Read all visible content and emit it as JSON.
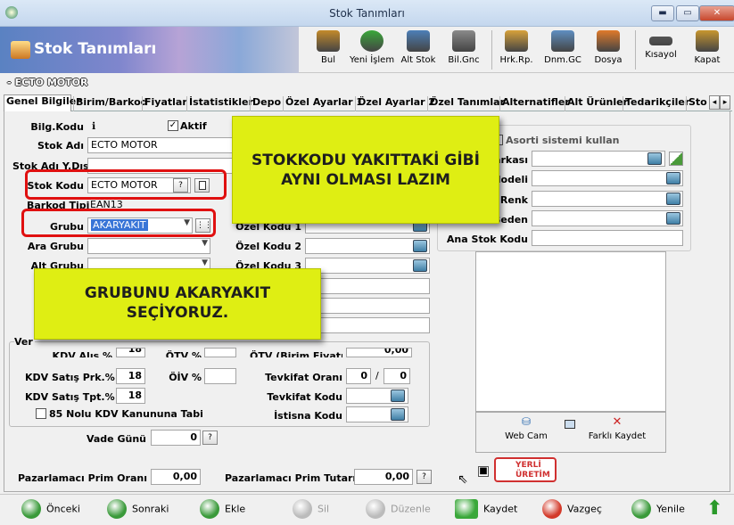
{
  "window": {
    "title": "Stok Tanımları",
    "min": "▬",
    "max": "▭",
    "close": "✕"
  },
  "banner": {
    "title": "Stok Tanımları"
  },
  "toolbar": [
    {
      "label": "Bul",
      "color": "#c48a2a"
    },
    {
      "label": "Yeni İşlem",
      "color": "#3aa83a"
    },
    {
      "label": "Alt Stok",
      "color": "#4d7fb8"
    },
    {
      "label": "Bil.Gnc",
      "color": "#8a8a8a"
    },
    {
      "label": "Hrk.Rp.",
      "color": "#d8a23a"
    },
    {
      "label": "Dnm.GC",
      "color": "#5f8fc2"
    },
    {
      "label": "Dosya",
      "color": "#e07a2a"
    },
    {
      "label": "Kısayol",
      "color": "#555555"
    },
    {
      "label": "Kapat",
      "color": "#c8962e"
    }
  ],
  "subheader": "ECTO MOTOR",
  "tabs": [
    "Genel Bilgiler",
    "Birim/Barkod",
    "Fiyatlar",
    "İstatistikler",
    "Depo",
    "Özel Ayarlar 1",
    "Özel Ayarlar 2",
    "Özel Tanımlar",
    "Alternatifler",
    "Alt Ürünler",
    "Tedarikçiler",
    "Stol"
  ],
  "tab_scroll": [
    "◂",
    "▸"
  ],
  "form": {
    "bilg_kodu_label": "Bilg.Kodu",
    "bilg_kodu_icon": "ℹ",
    "aktif_label": "Aktif",
    "aktif_check": "✓",
    "stok_adi_label": "Stok Adı",
    "stok_adi": "ECTO MOTOR",
    "stok_adi_y_label": "Stok Adı Y.Dışı",
    "stok_kodu_label": "Stok Kodu",
    "stok_kodu": "ECTO MOTOR",
    "stok_kodu_btn": "?",
    "barkod_tipi_label": "Barkod Tipi",
    "barkod_tipi": "EAN13",
    "grubu_label": "Grubu",
    "grubu": "AKARYAKIT",
    "ara_grubu_label": "Ara Grubu",
    "alt_grubu_label": "Alt Grubu",
    "ozel_kodu_1_label": "Özel Kodu 1",
    "ozel_kodu_2_label": "Özel Kodu 2",
    "ozel_kodu_3_label": "Özel Kodu 3",
    "ver_label": "Ver",
    "kdv_alis_label": "KDV Alış %",
    "kdv_alis": "18",
    "kdv_satis_prk_label": "KDV Satış Prk.%",
    "kdv_satis_prk": "18",
    "kdv_satis_tpt_label": "KDV Satış Tpt.%",
    "kdv_satis_tpt": "18",
    "otv_label": "ÖTV %",
    "oiv_label": "ÖİV %",
    "otv_birim_label": "ÖTV (Birim Fiyatı)",
    "otv_birim": "0,00",
    "tevkifat_orani_label": "Tevkifat Oranı",
    "tevkifat_1": "0",
    "tevkifat_sep": "/",
    "tevkifat_2": "0",
    "tevkifat_kodu_label": "Tevkifat Kodu",
    "istisna_kodu_label": "İstisna Kodu",
    "kdv85_label": "85 Nolu KDV Kanununa Tabi",
    "vade_gunu_label": "Vade Günü",
    "vade_gunu": "0",
    "vade_btn": "?",
    "paz_prim_orani_label": "Pazarlamacı Prim Oranı",
    "paz_prim_orani": "0,00",
    "paz_prim_tutari_label": "Pazarlamacı Prim Tutarı",
    "paz_prim_tutari": "0,00",
    "paz_btn": "?",
    "asorti_label": "Asorti sistemi kullan",
    "marka_label": "Markası",
    "model_label": "Modeli",
    "renk_label": "Renk",
    "beden_label": "Beden",
    "ana_stok_label": "Ana Stok Kodu",
    "webcam_label": "Web Cam",
    "farkli_kaydet_label": "Farklı Kaydet",
    "yerli_line1": "YERLİ",
    "yerli_line2": "ÜRETİM"
  },
  "notes": {
    "note1": "STOKKODU YAKITTAKİ GİBİ AYNI OLMASI LAZIM",
    "note2": "GRUBUNU AKARYAKIT SEÇİYORUZ."
  },
  "bottom": [
    {
      "label": "Önceki",
      "color": "#3a9a3a",
      "enabled": true
    },
    {
      "label": "Sonraki",
      "color": "#3a9a3a",
      "enabled": true
    },
    {
      "label": "Ekle",
      "color": "#3a9a3a",
      "enabled": true
    },
    {
      "label": "Sil",
      "color": "#bbbbbb",
      "enabled": false
    },
    {
      "label": "Düzenle",
      "color": "#bbbbbb",
      "enabled": false
    },
    {
      "label": "Kaydet",
      "color": "#3aa83a",
      "enabled": true
    },
    {
      "label": "Vazgeç",
      "color": "#d33a2a",
      "enabled": true
    },
    {
      "label": "Yenile",
      "color": "#3a9a3a",
      "enabled": true
    }
  ],
  "exit_icon": "⬆"
}
